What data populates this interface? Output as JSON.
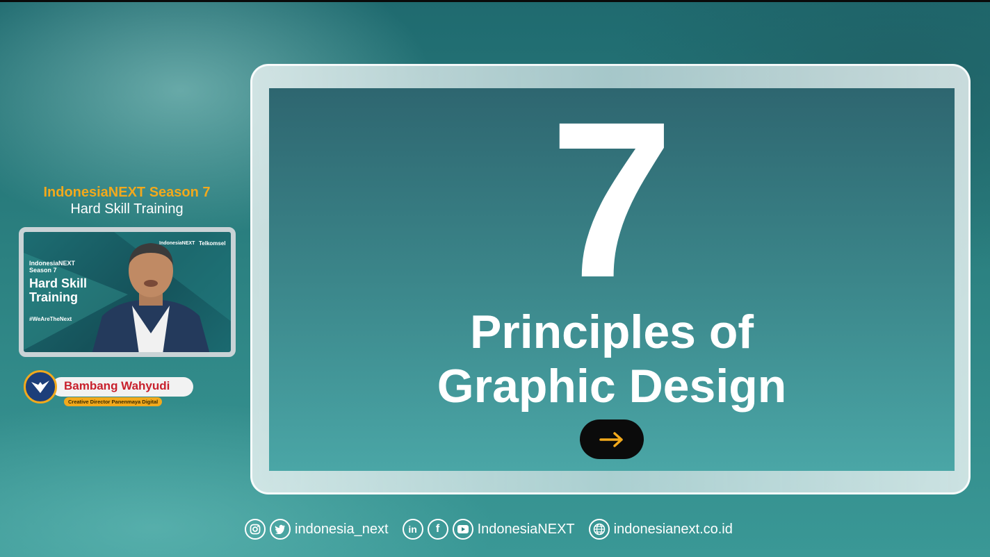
{
  "event": {
    "title_line1": "IndonesiaNEXT Season 7",
    "title_line2": "Hard Skill Training"
  },
  "video": {
    "small_title": "IndonesiaNEXT\nSeason 7",
    "big_title": "Hard Skill\nTraining",
    "hashtag": "#WeAreTheNext",
    "logo_left": "IndonesiaNEXT",
    "logo_right": "Telkomsel"
  },
  "speaker": {
    "name": "Bambang Wahyudi",
    "role": "Creative Director Panenmaya Digital"
  },
  "slide": {
    "number": "7",
    "title_line1": "Principles of",
    "title_line2": "Graphic Design",
    "button_icon": "arrow-right-icon"
  },
  "footer": {
    "handle1": "indonesia_next",
    "handle2": "IndonesiaNEXT",
    "website": "indonesianext.co.id",
    "icons": [
      "instagram-icon",
      "twitter-icon",
      "linkedin-icon",
      "facebook-icon",
      "youtube-icon",
      "globe-icon"
    ]
  },
  "colors": {
    "accent_orange": "#f2a91c",
    "name_red": "#c8202c",
    "teal": "#2b8080"
  }
}
